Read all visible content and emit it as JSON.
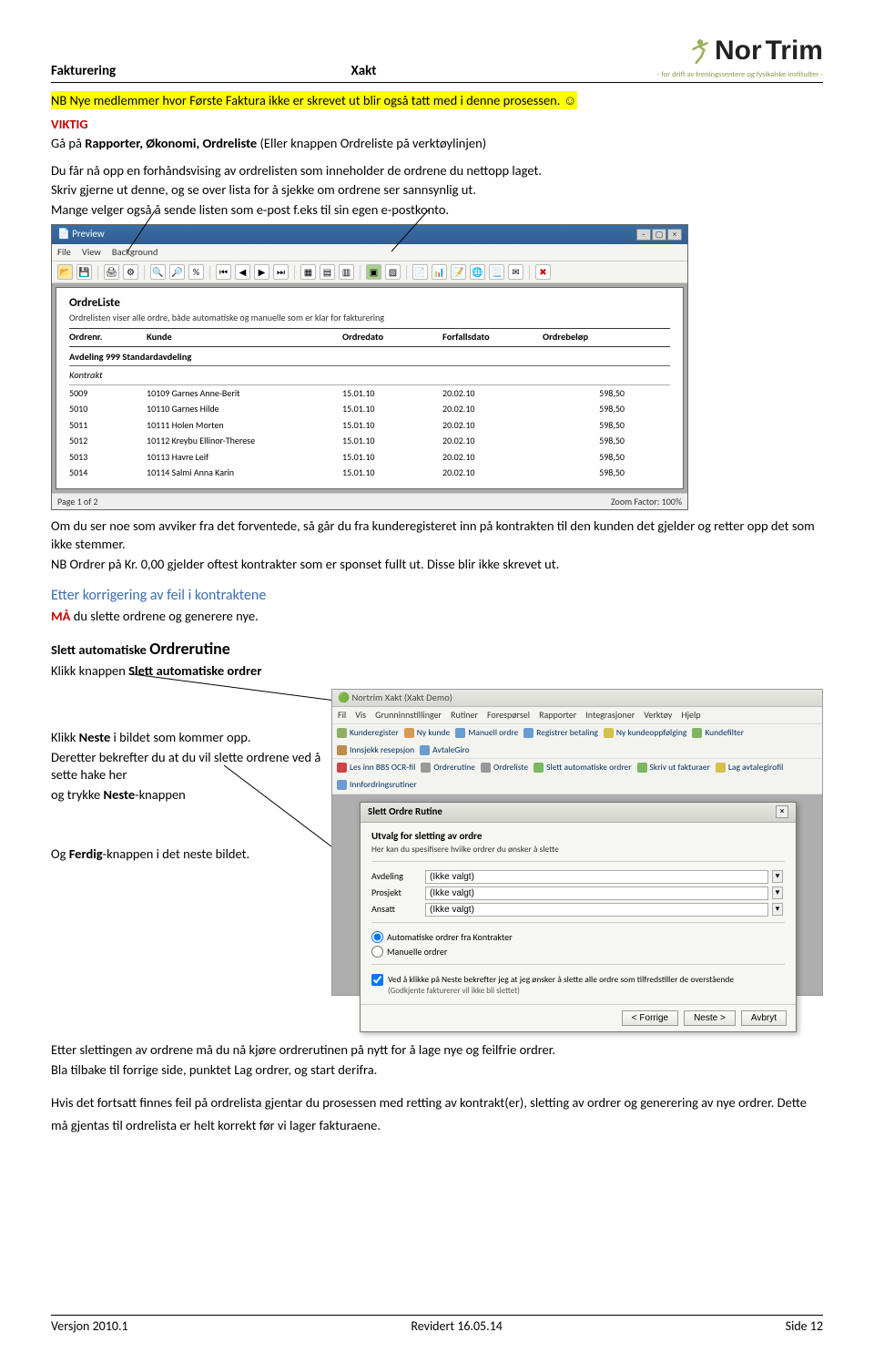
{
  "header": {
    "left": "Fakturering",
    "mid": "Xakt",
    "logo_main1": "Nor",
    "logo_main2": "Trim",
    "logo_tag": "- for drift av treningssentere og fysikalske institutter -"
  },
  "intro": {
    "highlight": "NB Nye medlemmer hvor Første Faktura ikke er skrevet ut blir også tatt med i denne prosessen. ☺",
    "viktig": "VIKTIG",
    "line1a": "Gå på ",
    "line1b": "Rapporter, Økonomi, Ordreliste",
    "line1c": " (Eller knappen Ordreliste på verktøylinjen)",
    "line2": "Du får nå opp en forhåndsvising av ordrelisten som inneholder de ordrene du nettopp laget.",
    "line3": "Skriv gjerne ut denne, og se over lista for å sjekke om ordrene ser sannsynlig ut.",
    "line4": "Mange velger også å sende listen som e-post f.eks til sin egen e-postkonto."
  },
  "shot1": {
    "title": "Preview",
    "menu": [
      "File",
      "View",
      "Background"
    ],
    "report_title": "OrdreListe",
    "report_sub": "Ordrelisten viser alle ordre, både automatiske og manuelle som er klar for fakturering",
    "cols": [
      "Ordrenr.",
      "Kunde",
      "Ordredato",
      "Forfallsdato",
      "Ordrebeløp"
    ],
    "section": "Avdeling 999 Standardavdeling",
    "subsection": "Kontrakt",
    "rows": [
      [
        "5009",
        "10109 Garnes Anne-Berit",
        "15.01.10",
        "20.02.10",
        "598,50"
      ],
      [
        "5010",
        "10110 Garnes Hilde",
        "15.01.10",
        "20.02.10",
        "598,50"
      ],
      [
        "5011",
        "10111 Holen Morten",
        "15.01.10",
        "20.02.10",
        "598,50"
      ],
      [
        "5012",
        "10112 Kreybu Ellinor-Therese",
        "15.01.10",
        "20.02.10",
        "598,50"
      ],
      [
        "5013",
        "10113 Havre Leif",
        "15.01.10",
        "20.02.10",
        "598,50"
      ],
      [
        "5014",
        "10114 Salmi Anna Karin",
        "15.01.10",
        "20.02.10",
        "598,50"
      ]
    ],
    "status_left": "Page 1 of 2",
    "status_right": "Zoom Factor: 100%"
  },
  "mid": {
    "p1": "Om du ser noe som avviker fra det forventede, så går du fra kunderegisteret inn på kontrakten til den kunden det gjelder og retter opp det som ikke stemmer.",
    "p2": "NB Ordrer på Kr. 0,00 gjelder oftest kontrakter som er sponset fullt ut. Disse blir ikke skrevet ut.",
    "h_blue": "Etter korrigering av feil i kontraktene",
    "ma": "MÅ",
    "ma_rest": "  du slette ordrene og generere nye.",
    "h3a": "Slett automatiske ",
    "h3b": "Ordrerutine",
    "p3a": "Klikk knappen ",
    "p3b": "Slett automatiske ordrer",
    "p4a": "Klikk ",
    "p4b": "Neste",
    "p4c": " i bildet som kommer opp.",
    "p5": "Deretter bekrefter du at du vil slette ordrene ved å sette hake her",
    "p6a": "og trykke ",
    "p6b": "Neste",
    "p6c": "-knappen",
    "p7a": "Og ",
    "p7b": "Ferdig",
    "p7c": "-knappen i det neste bildet."
  },
  "shot2": {
    "wintitle": "Nortrim Xakt (Xakt Demo)",
    "menu": [
      "Fil",
      "Vis",
      "Grunninnstillinger",
      "Rutiner",
      "Forespørsel",
      "Rapporter",
      "Integrasjoner",
      "Verktøy",
      "Hjelp"
    ],
    "toolbar1": [
      "Kunderegister",
      "Ny kunde",
      "Manuell ordre",
      "Registrer betaling",
      "Ny kundeoppfølging",
      "Kundefilter",
      "Innsjekk resepsjon",
      "AvtaleGiro"
    ],
    "toolbar2": [
      "Les inn BBS OCR-fil",
      "Ordrerutine",
      "Ordreliste",
      "Slett automatiske ordrer",
      "Skriv ut fakturaer",
      "Lag avtalegirofil",
      "Innfordringsrutiner"
    ],
    "dlg_title": "Slett Ordre Rutine",
    "dlg_h": "Utvalg for sletting av ordre",
    "dlg_s": "Her kan du spesifisere hvilke ordrer du ønsker å slette",
    "rows": [
      {
        "label": "Avdeling",
        "value": "(Ikke valgt)"
      },
      {
        "label": "Prosjekt",
        "value": "(Ikke valgt)"
      },
      {
        "label": "Ansatt",
        "value": "(Ikke valgt)"
      }
    ],
    "radio1": "Automatiske ordrer fra Kontrakter",
    "radio2": "Manuelle ordrer",
    "check": "Ved å klikke på Neste bekrefter jeg at jeg ønsker å slette alle ordre som tilfredstiller de overstående",
    "check_note": "(Godkjente fakturerer vil ikke bli slettet)",
    "btn_back": "< Forrige",
    "btn_next": "Neste >",
    "btn_cancel": "Avbryt"
  },
  "tail": {
    "p1": "Etter slettingen av ordrene må du nå kjøre ordrerutinen på nytt for å lage nye og feilfrie ordrer.",
    "p2": "Bla tilbake til forrige side, punktet Lag ordrer, og start derifra.",
    "p3": "Hvis det fortsatt finnes feil på ordrelista gjentar du prosessen med retting av kontrakt(er), sletting av ordrer og generering av nye ordrer. Dette må gjentas til ordrelista er helt korrekt før vi lager fakturaene."
  },
  "footer": {
    "l": "Versjon 2010.1",
    "m": "Revidert 16.05.14",
    "r": "Side 12"
  }
}
